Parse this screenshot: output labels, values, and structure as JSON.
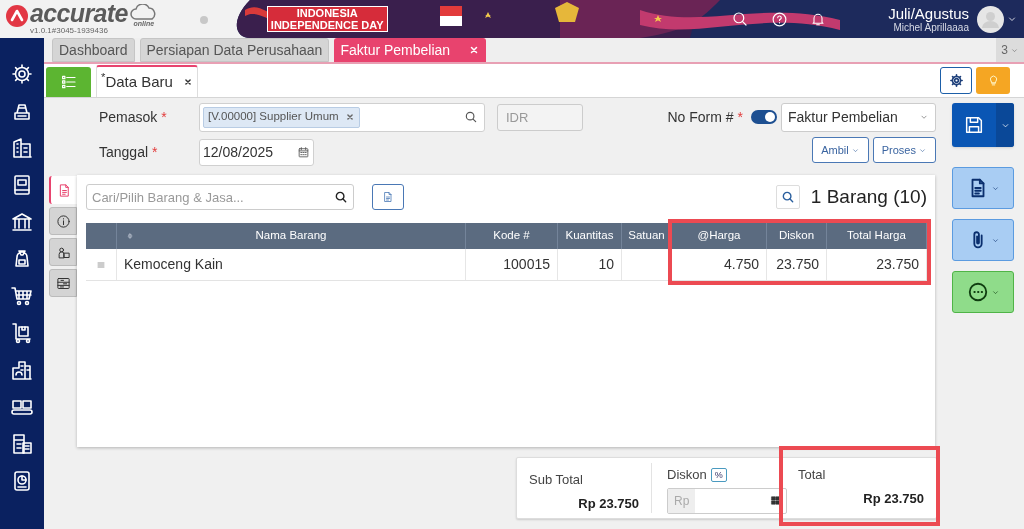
{
  "app": {
    "logo_text": "accurate",
    "logo_suffix": "online",
    "version": "v1.0.1#3045-1939436"
  },
  "banner": {
    "line_1": "INDONESIA",
    "line_2": "INDEPENDENCE DAY"
  },
  "user": {
    "period": "Juli/Agustus",
    "name": "Michel Aprillaaaa"
  },
  "tabs": [
    {
      "label": "Dashboard",
      "selected": false,
      "closable": false
    },
    {
      "label": "Persiapan Data Perusahaan",
      "selected": false,
      "closable": false
    },
    {
      "label": "Faktur Pembelian",
      "selected": true,
      "closable": true
    }
  ],
  "tab_overflow": "3",
  "subtabs": [
    {
      "label": "$^{*}$Data Baru",
      "selected": true,
      "closable": true
    }
  ],
  "form": {
    "supplier": {
      "label": "Pemasok",
      "mark": "*",
      "chip": "[V.00000] Supplier Umum"
    },
    "currency": {
      "placeholder": "IDR"
    },
    "form_no": {
      "label": "No Form #",
      "mark": "*",
      "auto": true,
      "value": "Faktur Pembelian"
    },
    "date": {
      "label": "Tanggal",
      "mark": "*",
      "value": "12/08/2025"
    },
    "buttons": [
      "Ambil",
      "Proses"
    ]
  },
  "side_tabs": [
    {
      "kind": "detail",
      "selected": true
    },
    {
      "kind": "info",
      "selected": false
    },
    {
      "kind": "cost",
      "selected": false
    },
    {
      "kind": "other",
      "selected": false
    }
  ],
  "item_search": {
    "placeholder": "Cari/Pilih Barang & Jasa..."
  },
  "item_count": "1 Barang (10)",
  "table": {
    "columns": [
      {
        "label": "Nama Barang",
        "sortable": true,
        "highlighted": false
      },
      {
        "label": "Kode #",
        "sortable": false,
        "highlighted": false
      },
      {
        "label": "Kuantitas",
        "sortable": false,
        "highlighted": false
      },
      {
        "label": "Satuan",
        "sortable": false,
        "highlighted": false
      },
      {
        "label": "@Harga",
        "sortable": false,
        "highlighted": true
      },
      {
        "label": "Diskon",
        "sortable": false,
        "highlighted": true
      },
      {
        "label": "Total Harga",
        "sortable": false,
        "highlighted": true
      }
    ],
    "rows": [
      {
        "cells": [
          "Kemoceng Kain",
          "100015",
          "10",
          null,
          "4.750",
          "23.750",
          "23.750"
        ]
      }
    ]
  },
  "summary": {
    "subtotal": {
      "label": "Sub Total",
      "value": "Rp 23.750"
    },
    "discount": {
      "label": "Diskon",
      "badge": "%",
      "prefix": "Rp"
    },
    "total": {
      "label": "Total",
      "value": "Rp 23.750",
      "highlighted": true
    }
  }
}
